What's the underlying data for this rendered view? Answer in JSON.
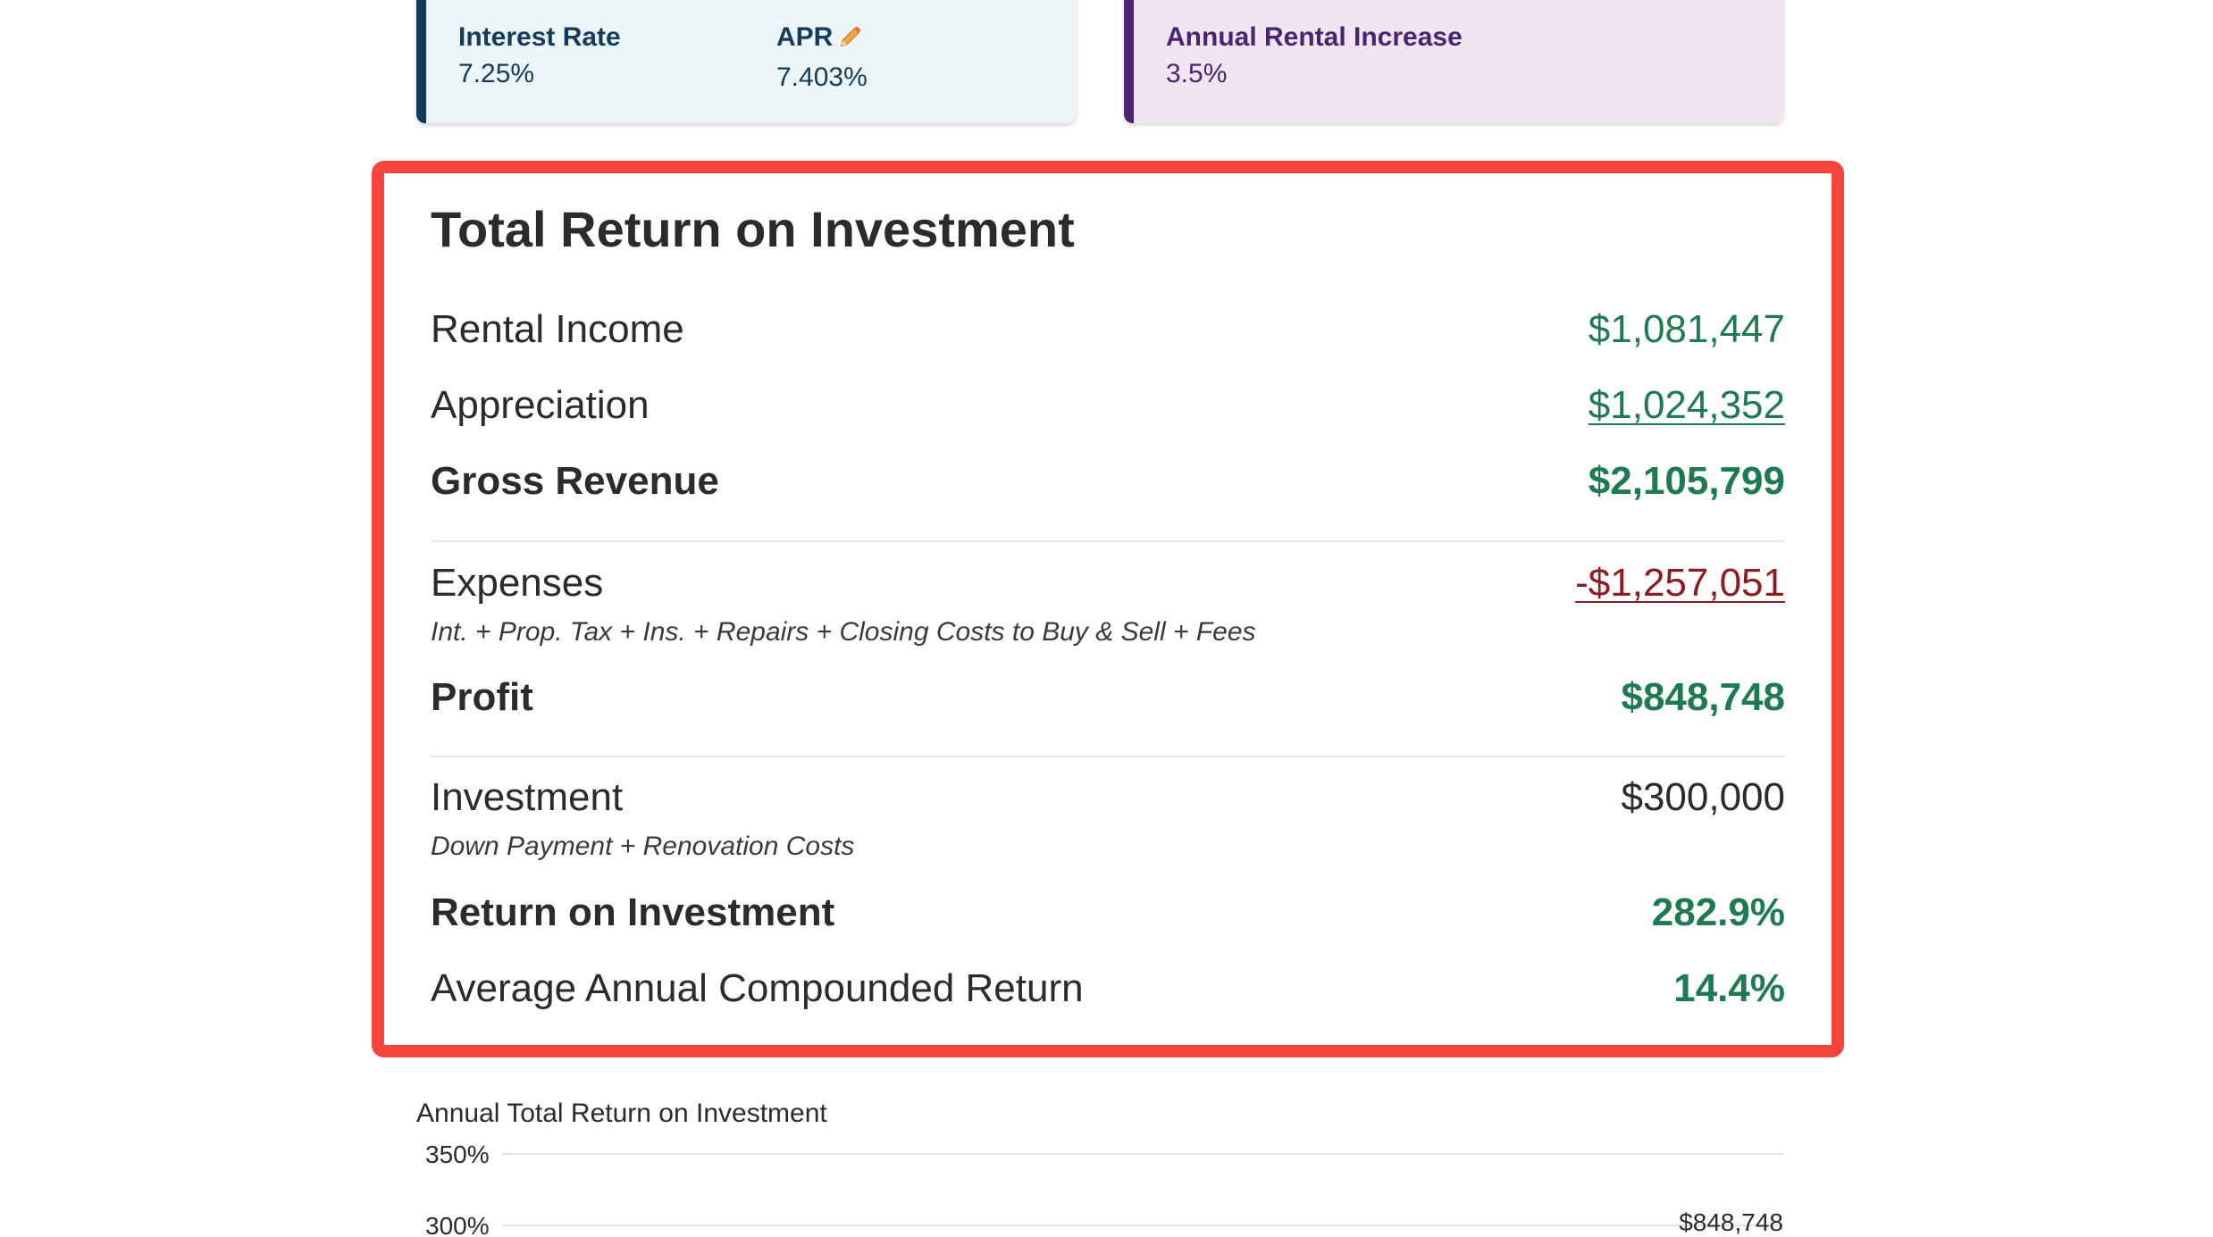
{
  "loan_card": {
    "interest_rate_label": "Interest Rate",
    "interest_rate_value": "7.25%",
    "apr_label": "APR",
    "apr_value": "7.403%",
    "apr_icon": "pencil-icon",
    "accent_color": "#0f3b5f"
  },
  "rent_card": {
    "annual_increase_label": "Annual Rental Increase",
    "annual_increase_value": "3.5%",
    "accent_color": "#4a2470"
  },
  "roi": {
    "title": "Total Return on Investment",
    "rental_income_label": "Rental Income",
    "rental_income_value": "$1,081,447",
    "appreciation_label": "Appreciation",
    "appreciation_value": "$1,024,352",
    "gross_revenue_label": "Gross Revenue",
    "gross_revenue_value": "$2,105,799",
    "expenses_label": "Expenses",
    "expenses_note": "Int. + Prop. Tax + Ins. + Repairs + Closing Costs to Buy & Sell + Fees",
    "expenses_value": "-$1,257,051",
    "profit_label": "Profit",
    "profit_value": "$848,748",
    "investment_label": "Investment",
    "investment_note": "Down Payment + Renovation Costs",
    "investment_value": "$300,000",
    "return_label": "Return on Investment",
    "return_value": "282.9%",
    "avg_return_label": "Average Annual Compounded Return",
    "avg_return_value": "14.4%",
    "positive_color": "#1e7a52",
    "negative_color": "#8e1a22",
    "highlight_color": "#f4443b"
  },
  "chart_data": {
    "type": "line",
    "title": "Annual Total Return on Investment",
    "y_ticks": [
      "350%",
      "300%"
    ],
    "annotations": [
      "$848,748"
    ],
    "grid": true
  }
}
